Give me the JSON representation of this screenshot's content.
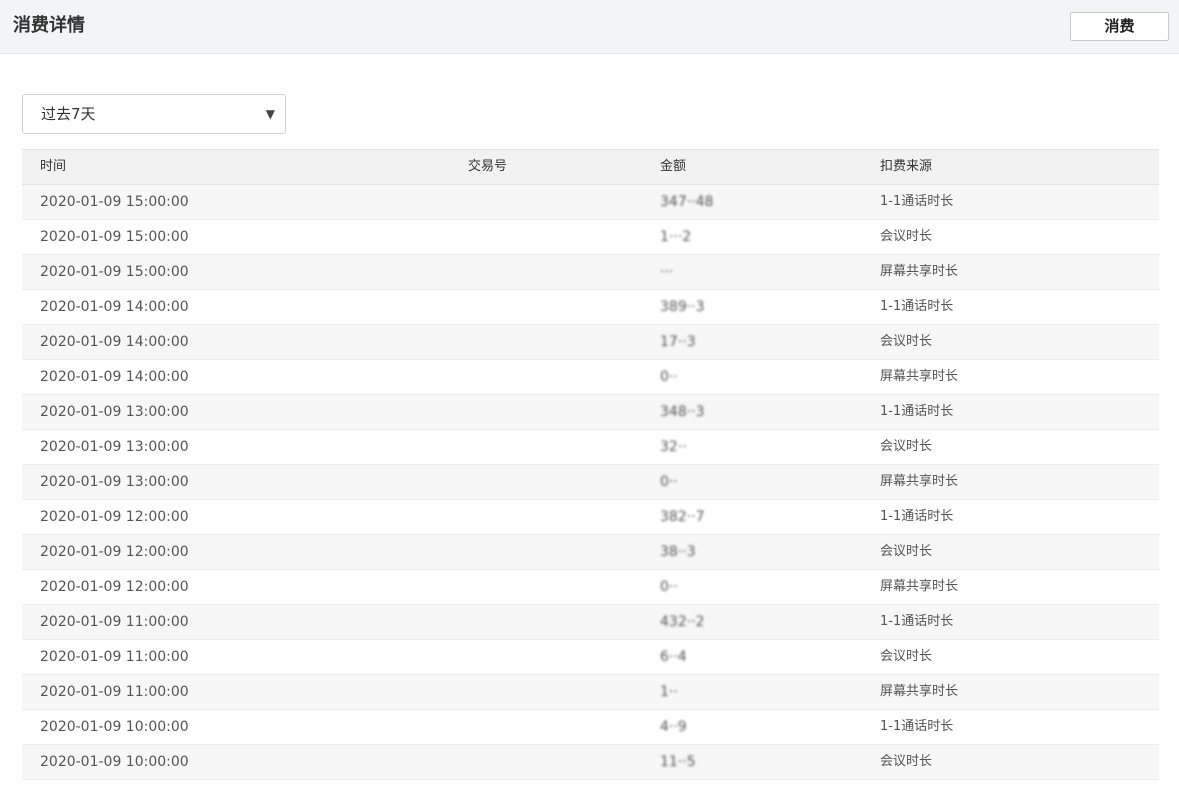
{
  "header": {
    "title": "消费详情",
    "button_label": "消费"
  },
  "filter": {
    "selected": "过去7天",
    "caret": "▼"
  },
  "table": {
    "columns": [
      "时间",
      "交易号",
      "金额",
      "扣费来源"
    ],
    "rows": [
      {
        "time": "2020-01-09 15:00:00",
        "tx": "",
        "amount": "347··48",
        "source": "1-1通话时长"
      },
      {
        "time": "2020-01-09 15:00:00",
        "tx": "",
        "amount": "1···2",
        "source": "会议时长"
      },
      {
        "time": "2020-01-09 15:00:00",
        "tx": "",
        "amount": "···",
        "source": "屏幕共享时长"
      },
      {
        "time": "2020-01-09 14:00:00",
        "tx": "",
        "amount": "389··3",
        "source": "1-1通话时长"
      },
      {
        "time": "2020-01-09 14:00:00",
        "tx": "",
        "amount": "17··3",
        "source": "会议时长"
      },
      {
        "time": "2020-01-09 14:00:00",
        "tx": "",
        "amount": "0··",
        "source": "屏幕共享时长"
      },
      {
        "time": "2020-01-09 13:00:00",
        "tx": "",
        "amount": "348··3",
        "source": "1-1通话时长"
      },
      {
        "time": "2020-01-09 13:00:00",
        "tx": "",
        "amount": "32··",
        "source": "会议时长"
      },
      {
        "time": "2020-01-09 13:00:00",
        "tx": "",
        "amount": "0··",
        "source": "屏幕共享时长"
      },
      {
        "time": "2020-01-09 12:00:00",
        "tx": "",
        "amount": "382··7",
        "source": "1-1通话时长"
      },
      {
        "time": "2020-01-09 12:00:00",
        "tx": "",
        "amount": "38··3",
        "source": "会议时长"
      },
      {
        "time": "2020-01-09 12:00:00",
        "tx": "",
        "amount": "0··",
        "source": "屏幕共享时长"
      },
      {
        "time": "2020-01-09 11:00:00",
        "tx": "",
        "amount": "432··2",
        "source": "1-1通话时长"
      },
      {
        "time": "2020-01-09 11:00:00",
        "tx": "",
        "amount": "6··4",
        "source": "会议时长"
      },
      {
        "time": "2020-01-09 11:00:00",
        "tx": "",
        "amount": "1··",
        "source": "屏幕共享时长"
      },
      {
        "time": "2020-01-09 10:00:00",
        "tx": "",
        "amount": "4··9",
        "source": "1-1通话时长"
      },
      {
        "time": "2020-01-09 10:00:00",
        "tx": "",
        "amount": "11··5",
        "source": "会议时长"
      }
    ]
  }
}
